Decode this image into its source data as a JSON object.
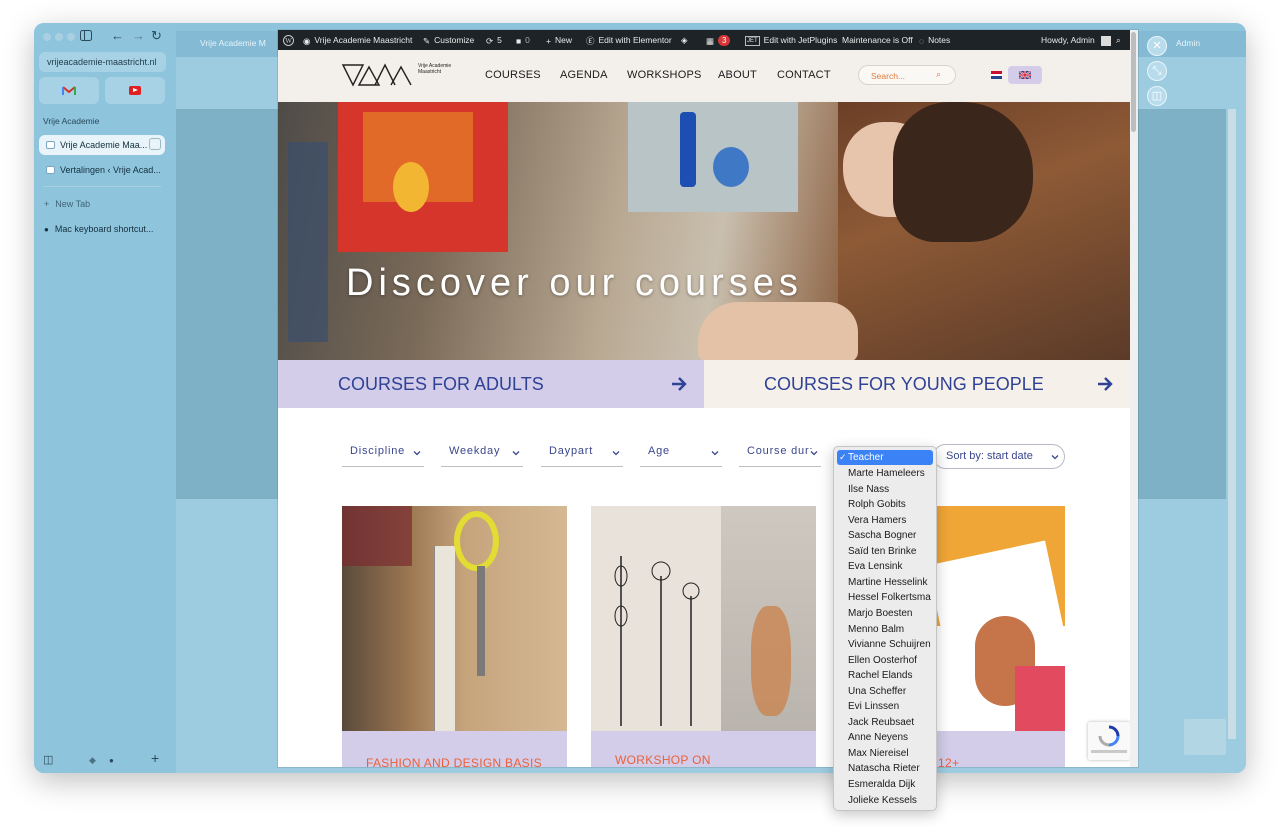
{
  "browser": {
    "url": "vrijeacademie-maastricht.nl",
    "sidebar_section": "Vrije Academie",
    "tabs": [
      {
        "label": "Vrije Academie Maa...",
        "active": true
      },
      {
        "label": "Vertalingen ‹ Vrije Acad...",
        "active": false
      }
    ],
    "new_tab_label": "New Tab",
    "extra_tab": "Mac keyboard shortcut...",
    "bg_tab_label": "Vrije Academie M",
    "bg_admin_label": "Admin"
  },
  "wp_bar": {
    "site_name": "Vrije Academie Maastricht",
    "customize": "Customize",
    "updates": "5",
    "comments": "0",
    "new": "New",
    "edit_elementor": "Edit with Elementor",
    "badge": "3",
    "edit_jet": "Edit with JetPlugins",
    "maintenance": "Maintenance is Off",
    "notes": "Notes",
    "howdy": "Howdy, Admin"
  },
  "header": {
    "logo_line1": "Vrije Academie",
    "logo_line2": "Maastricht",
    "nav": [
      "COURSES",
      "AGENDA",
      "WORKSHOPS",
      "ABOUT",
      "CONTACT"
    ],
    "search_placeholder": "Search..."
  },
  "hero": {
    "title": "Discover our courses"
  },
  "categories": [
    {
      "label": "COURSES FOR ADULTS"
    },
    {
      "label": "COURSES FOR YOUNG PEOPLE"
    }
  ],
  "filters": [
    "Discipline",
    "Weekday",
    "Daypart",
    "Age",
    "Course dur:"
  ],
  "sort_label": "Sort by: start date",
  "cards": [
    {
      "title": "FASHION AND DESIGN BASIS"
    },
    {
      "title": "WORKSHOP ON"
    },
    {
      "title": "12+"
    }
  ],
  "dropdown": {
    "selected": "Teacher",
    "options": [
      "Marte Hameleers",
      "Ilse Nass",
      "Rolph Gobits",
      "Vera Hamers",
      "Sascha Bogner",
      "Saïd ten Brinke",
      "Eva Lensink",
      "Martine Hesselink",
      "Hessel Folkertsma",
      "Marjo Boesten",
      "Menno Balm",
      "Vivianne Schuijren",
      "Ellen Oosterhof",
      "Rachel Elands",
      "Una Scheffer",
      "Evi Linssen",
      "Jack Reubsaet",
      "Anne Neyens",
      "Max Niereisel",
      "Natascha Rieter",
      "Esmeralda Dijk",
      "Jolieke Kessels"
    ]
  },
  "colors": {
    "nav_blue": "#2f4296",
    "accent_orange": "#e8613b",
    "lavender": "#d3cde9",
    "select_blue": "#3b82f7",
    "wp_dark": "#1d2327"
  }
}
